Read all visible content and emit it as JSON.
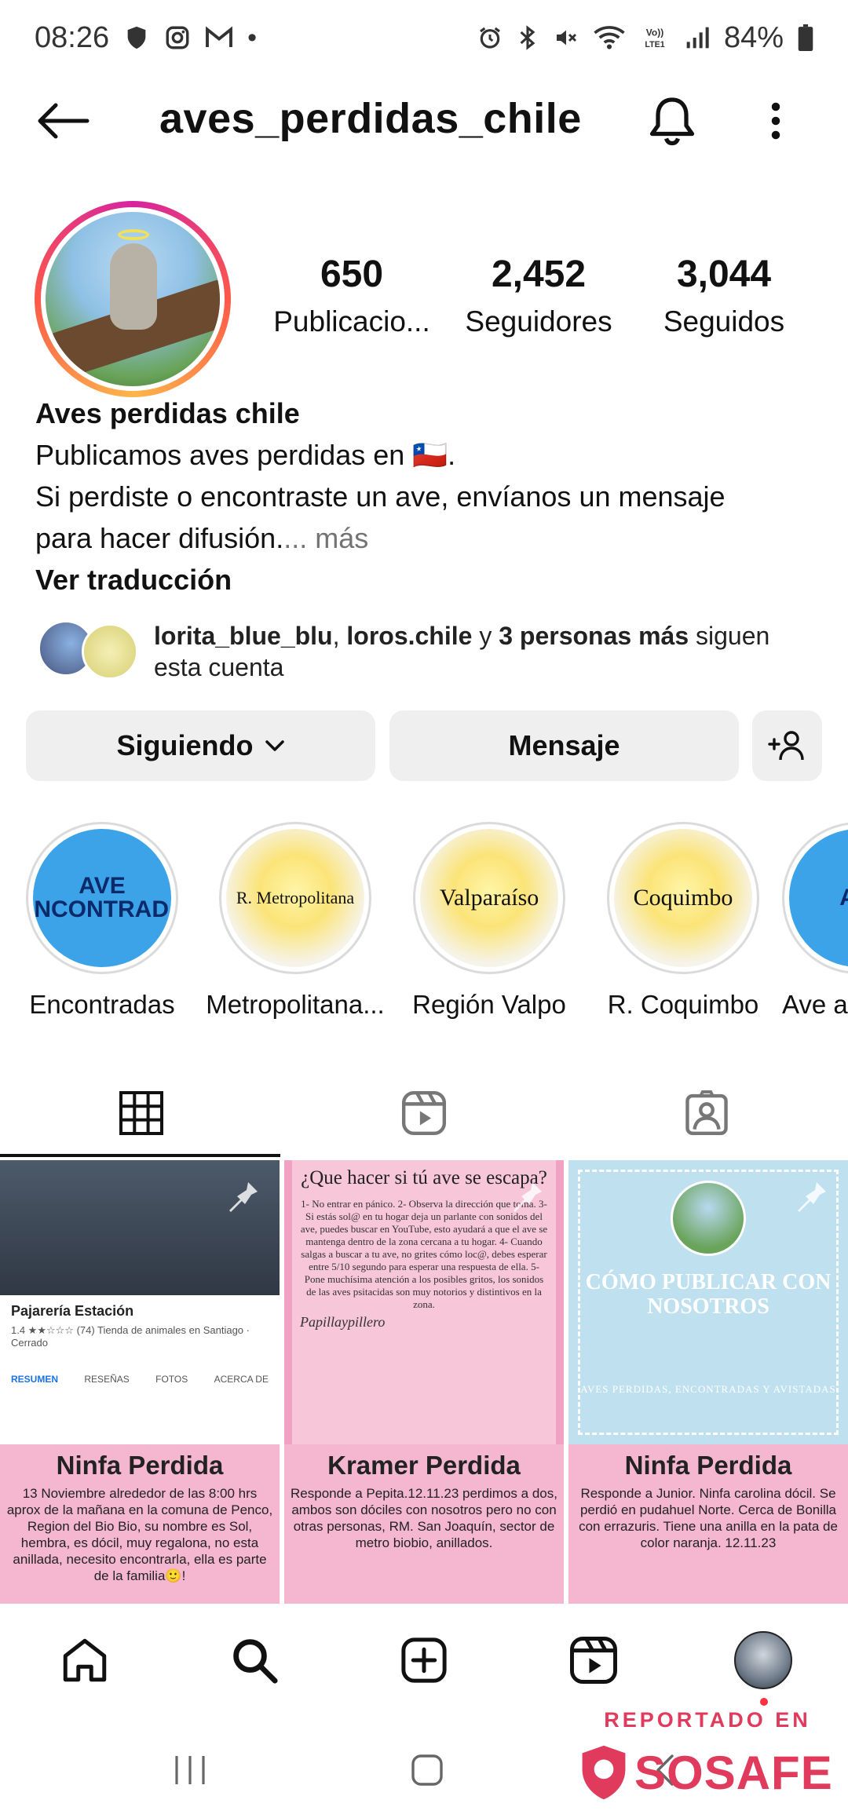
{
  "status_bar": {
    "time": "08:26",
    "battery": "84%",
    "left_icons": [
      "shield-icon",
      "instagram-icon",
      "gmail-icon",
      "dot-icon"
    ],
    "right_icons": [
      "alarm-icon",
      "bluetooth-icon",
      "mute-icon",
      "wifi-icon",
      "volte-icon",
      "signal-icon",
      "battery-icon"
    ]
  },
  "header": {
    "username": "aves_perdidas_chile"
  },
  "stats": {
    "posts_value": "650",
    "posts_label": "Publicacio...",
    "followers_value": "2,452",
    "followers_label": "Seguidores",
    "following_value": "3,044",
    "following_label": "Seguidos"
  },
  "bio": {
    "name": "Aves perdidas chile",
    "line1": "Publicamos aves perdidas en 🇨🇱.",
    "line2": "Si perdiste o encontraste un ave, envíanos un mensaje",
    "line3": "para hacer difusión.",
    "more": "... más",
    "translate": "Ver traducción"
  },
  "followed_by": {
    "user1": "lorita_blue_blu",
    "separator": ", ",
    "user2": "loros.chile",
    "middle": " y ",
    "others": "3 personas más",
    "suffix": " siguen esta cuenta"
  },
  "buttons": {
    "following": "Siguiendo",
    "message": "Mensaje"
  },
  "highlights": [
    {
      "image_text": "AVE ENCONTRADA",
      "label": "Encontradas"
    },
    {
      "image_text": "R. Metropolitana",
      "label": "Metropolitana..."
    },
    {
      "image_text": "Valparaíso",
      "label": "Región Valpo"
    },
    {
      "image_text": "Coquimbo",
      "label": "R. Coquimbo"
    },
    {
      "image_text": "AVI",
      "label": "Ave a"
    }
  ],
  "posts": [
    {
      "card_title": "Pajarería Estación",
      "card_sub": "1.4 ★★☆☆☆ (74)  Tienda de animales en Santiago · Cerrado",
      "card_tabs": [
        "RESUMEN",
        "RESEÑAS",
        "FOTOS",
        "ACERCA DE"
      ],
      "title": "Ninfa Perdida",
      "desc": "13 Noviembre alrededor de las 8:00 hrs aprox de la mañana en la comuna de Penco, Region del Bio Bio, su nombre es Sol, hembra, es dócil, muy regalona, no esta anillada, necesito encontrarla, ella es parte de la familia🙂!"
    },
    {
      "image_title": "¿Que hacer si tú ave se escapa?",
      "image_body": "1- No entrar en pánico. 2- Observa la dirección que toma. 3- Si estás sol@ en tu hogar deja un parlante con sonidos del ave, puedes buscar en YouTube, esto ayudará a que el ave se mantenga dentro de la zona cercana a tu hogar. 4- Cuando salgas a buscar a tu ave, no grites cómo loc@, debes esperar entre 5/10 segundo para esperar una respuesta de ella. 5- Pone muchísima atención a los posibles gritos, los sonidos de las aves psitacidas son muy notorios y distintivos en la zona.",
      "image_sign": "Papillaypillero",
      "title": "Kramer Perdida",
      "desc": "Responde a Pepita.12.11.23 perdimos a dos, ambos son dóciles con nosotros pero no con otras personas, RM. San Joaquín, sector de metro biobio, anillados."
    },
    {
      "image_title": "CÓMO PUBLICAR CON NOSOTROS",
      "image_sub": "AVES PERDIDAS, ENCONTRADAS Y AVISTADAS",
      "title": "Ninfa Perdida",
      "desc": "Responde a Junior. Ninfa carolina dócil. Se perdió en pudahuel Norte. Cerca de Bonilla con errazuris. Tiene una anilla en la pata de color naranja. 12.11.23"
    }
  ],
  "watermark": {
    "caption": "REPORTADO EN",
    "brand": "SOSAFE"
  },
  "colors": {
    "accent_pink": "#f4b7cf",
    "watermark_red": "#e03a5c",
    "highlight_blue": "#3da3e8",
    "notification_dot": "#ff3040"
  }
}
